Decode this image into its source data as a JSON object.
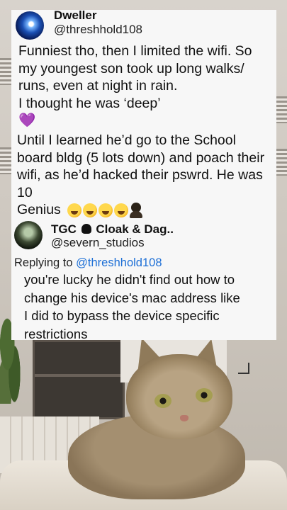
{
  "tweet": {
    "display_name": "Dweller",
    "handle": "@threshhold108",
    "lines": [
      "Funniest tho, then I limited the wifi. So",
      "my youngest son took up long walks/",
      "runs, even at night in rain.",
      "I thought he was ‘deep’"
    ],
    "heart_emoji": "💜",
    "lines2": [
      "Until I learned he’d go to the School",
      "board bldg (5 lots down) and poach their",
      "wifi, as he’d hacked their pswrd. He was",
      "10"
    ],
    "closing": "Genius"
  },
  "reply": {
    "display_name": "TGC",
    "display_name_suffix": "Cloak & Dag..",
    "handle": "@severn_studios",
    "replying_prefix": "Replying to",
    "replying_mention": "@threshhold108",
    "lines": [
      "you're lucky he didn't find out how to",
      "change his device's mac address like",
      "I did to bypass the device specific",
      "restrictions"
    ]
  },
  "colors": {
    "card_bg": "#f7f7f7",
    "mention": "#1d6fd6",
    "heart": "#7a2fb5"
  },
  "icons": [
    "rofl-emoji-icon",
    "facepalm-emoji-icon",
    "purple-heart-icon",
    "hood-icon"
  ]
}
